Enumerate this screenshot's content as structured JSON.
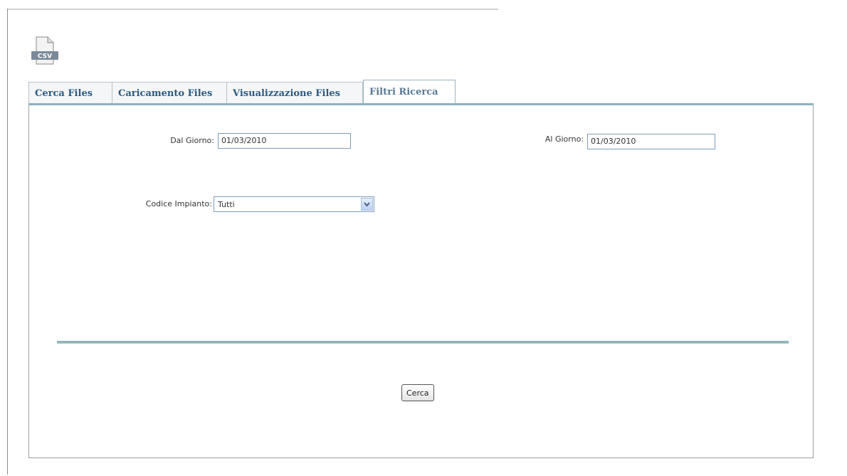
{
  "icons": {
    "header_icon": "csv-file-icon",
    "header_icon_text": "CSV",
    "dropdown_arrow": "chevron-down-icon"
  },
  "tabs": [
    {
      "label": "Cerca Files",
      "active": false
    },
    {
      "label": "Caricamento Files",
      "active": false
    },
    {
      "label": "Visualizzazione Files",
      "active": false
    },
    {
      "label": "Filtri Ricerca",
      "active": true
    }
  ],
  "filters": {
    "dal_giorno": {
      "label": "Dal Giorno:",
      "value": "01/03/2010"
    },
    "al_giorno": {
      "label": "Al Giorno:",
      "value": "01/03/2010"
    },
    "codice_impianto": {
      "label": "Codice Impianto:",
      "selected": "Tutti"
    }
  },
  "actions": {
    "search_label": "Cerca"
  },
  "colors": {
    "tab_text": "#2c5a83",
    "accent_rule": "#8eb0bd",
    "input_border": "#7f9db9"
  }
}
